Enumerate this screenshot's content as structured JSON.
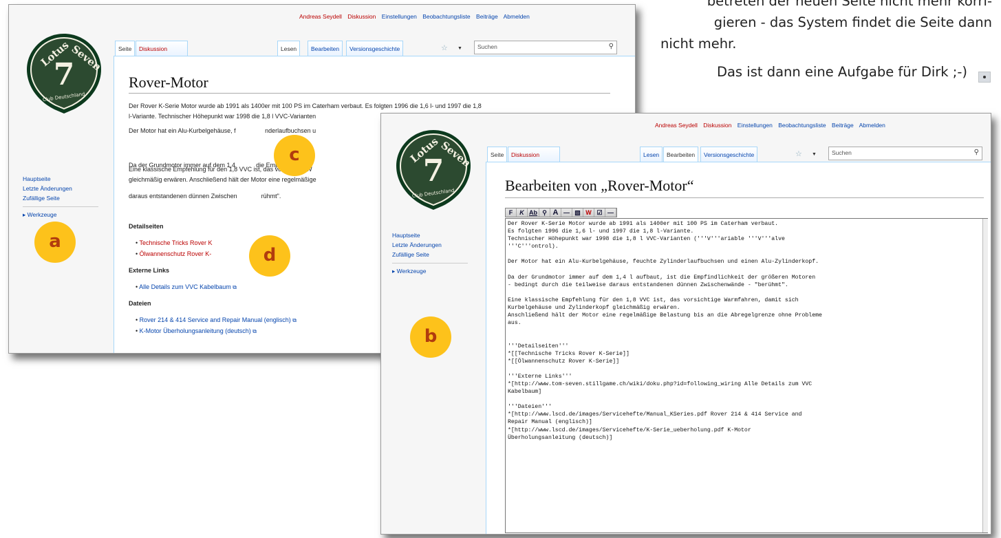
{
  "side_text": {
    "lines": [
      "betreten der neuen Seite nicht mehr korri-",
      "gieren - das System findet die Seite dann",
      "nicht mehr."
    ],
    "last": "Das ist dann eine Aufgabe für Dirk ;-)"
  },
  "logo": {
    "top": "Lotus",
    "right": "Seven",
    "number": "7",
    "bottom": "Club Deutschland",
    "colors": {
      "outer": "#0d3a1e",
      "inner": "#2c4a30",
      "text": "#f4f1e2"
    }
  },
  "win1": {
    "personal": {
      "user": "Andreas Seydell",
      "discussion": "Diskussion",
      "settings": "Einstellungen",
      "watchlist": "Beobachtungsliste",
      "contributions": "Beiträge",
      "logout": "Abmelden"
    },
    "tabs": {
      "page": "Seite",
      "discussion": "Diskussion",
      "read": "Lesen",
      "edit": "Bearbeiten",
      "history": "Versionsgeschichte"
    },
    "search_placeholder": "Suchen",
    "nav": {
      "main": "Hauptseite",
      "recent": "Letzte Änderungen",
      "random": "Zufällige Seite",
      "tools": "Werkzeuge"
    },
    "title": "Rover-Motor",
    "paragraphs": [
      "Der Rover K-Serie Motor wurde ab 1991 als 1400er mit 100 PS im Caterham verbaut. Es folgten 1996 die 1,6 l- und 1997 die 1,8",
      "l-Variante. Technischer Höhepunkt war 1998 die 1,8 l VVC-Varianten",
      "Der Motor hat ein Alu-Kurbelgehäuse, f                 nderlaufbuchsen u",
      "Da der Grundmotor immer auf dem 1,4            die Empfindlichke",
      "daraus entstandenen dünnen Zwischen              rühmt\".",
      "Eine klassische Empfehlung für den 1,8 VVC ist, das vorsichtige W",
      "gleichmäßig erwären. Anschließend hält der Motor eine regelmäßige"
    ],
    "sections": {
      "detail": "Detailseiten",
      "detail_items": [
        "Technische Tricks Rover K",
        "Ölwannenschutz Rover K-"
      ],
      "external": "Externe Links",
      "external_items": [
        "Alle Details zum VVC Kabelbaum"
      ],
      "files": "Dateien",
      "files_items": [
        "Rover 214 & 414 Service and Repair Manual (englisch)",
        "K-Motor Überholungsanleitung (deutsch)"
      ]
    }
  },
  "win2": {
    "personal": {
      "user": "Andreas Seydell",
      "discussion": "Diskussion",
      "settings": "Einstellungen",
      "watchlist": "Beobachtungsliste",
      "contributions": "Beiträge",
      "logout": "Abmelden"
    },
    "tabs": {
      "page": "Seite",
      "discussion": "Diskussion",
      "read": "Lesen",
      "edit": "Bearbeiten",
      "history": "Versionsgeschichte"
    },
    "search_placeholder": "Suchen",
    "nav": {
      "main": "Hauptseite",
      "recent": "Letzte Änderungen",
      "random": "Zufällige Seite",
      "tools": "Werkzeuge"
    },
    "title": "Bearbeiten von „Rover-Motor“",
    "toolbar": [
      "F",
      "K",
      "Ab",
      "⚲",
      "A",
      "—",
      "▧",
      "W",
      "☑",
      "—"
    ],
    "editor_text": "Der Rover K-Serie Motor wurde ab 1991 als 1400er mit 100 PS im Caterham verbaut.\nEs folgten 1996 die 1,6 l- und 1997 die 1,8 l-Variante.\nTechnischer Höhepunkt war 1998 die 1,8 l VVC-Varianten ('''V'''ariable '''V'''alve\n'''C'''ontrol).\n\nDer Motor hat ein Alu-Kurbelgehäuse, feuchte Zylinderlaufbuchsen und einen Alu-Zylinderkopf.\n\nDa der Grundmotor immer auf dem 1,4 l aufbaut, ist die Empfindlichkeit der größeren Motoren\n- bedingt durch die teilweise daraus entstandenen dünnen Zwischenwände - \"berühmt\".\n\nEine klassische Empfehlung für den 1,8 VVC ist, das vorsichtige Warmfahren, damit sich\nKurbelgehäuse und Zylinderkopf gleichmäßig erwären.\nAnschließend hält der Motor eine regelmäßige Belastung bis an die Abregelgrenze ohne Probleme\naus.\n\n\n'''Detailseiten'''\n*[[Technische Tricks Rover K-Serie]]\n*[[Ölwannenschutz Rover K-Serie]]\n\n'''Externe Links'''\n*[http://www.tom-seven.stillgame.ch/wiki/doku.php?id=following_wiring Alle Details zum VVC\nKabelbaum]\n\n'''Dateien'''\n*[http://www.lscd.de/images/Servicehefte/Manual_KSeries.pdf Rover 214 & 414 Service and\nRepair Manual (englisch)]\n*[http://www.lscd.de/images/Servicehefte/K-Serie_ueberholung.pdf K-Motor\nÜberholungsanleitung (deutsch)]"
  },
  "badges": {
    "a": "a",
    "b": "b",
    "c": "c",
    "d": "d"
  },
  "badge_color": "#fdc21b",
  "badge_text_color": "#b13c0e"
}
